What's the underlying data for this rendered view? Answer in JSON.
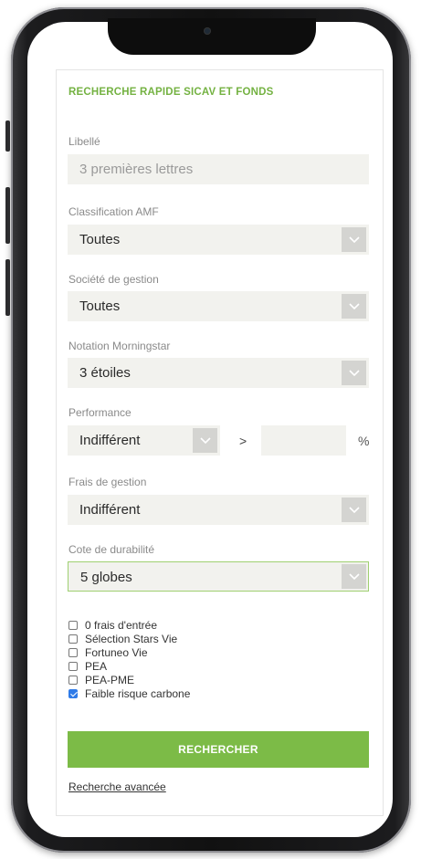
{
  "form": {
    "title": "RECHERCHE RAPIDE SICAV ET FONDS",
    "libelle": {
      "label": "Libellé",
      "placeholder": "3 premières lettres"
    },
    "classification": {
      "label": "Classification AMF",
      "value": "Toutes"
    },
    "societe": {
      "label": "Société de gestion",
      "value": "Toutes"
    },
    "notation": {
      "label": "Notation Morningstar",
      "value": "3 étoiles"
    },
    "performance": {
      "label": "Performance",
      "value": "Indifférent",
      "comparator": ">",
      "unit": "%",
      "amount": ""
    },
    "frais": {
      "label": "Frais de gestion",
      "value": "Indifférent"
    },
    "cote": {
      "label": "Cote de durabilité",
      "value": "5 globes"
    },
    "checkboxes": [
      {
        "label": "0 frais d'entrée",
        "checked": false
      },
      {
        "label": "Sélection Stars Vie",
        "checked": false
      },
      {
        "label": "Fortuneo Vie",
        "checked": false
      },
      {
        "label": "PEA",
        "checked": false
      },
      {
        "label": "PEA-PME",
        "checked": false
      },
      {
        "label": "Faible risque carbone",
        "checked": true
      }
    ],
    "search_button": "RECHERCHER",
    "advanced_link": "Recherche avancée"
  },
  "colors": {
    "accent_green": "#7cbb47",
    "title_green": "#74b242",
    "checkbox_blue": "#2f7be8"
  }
}
